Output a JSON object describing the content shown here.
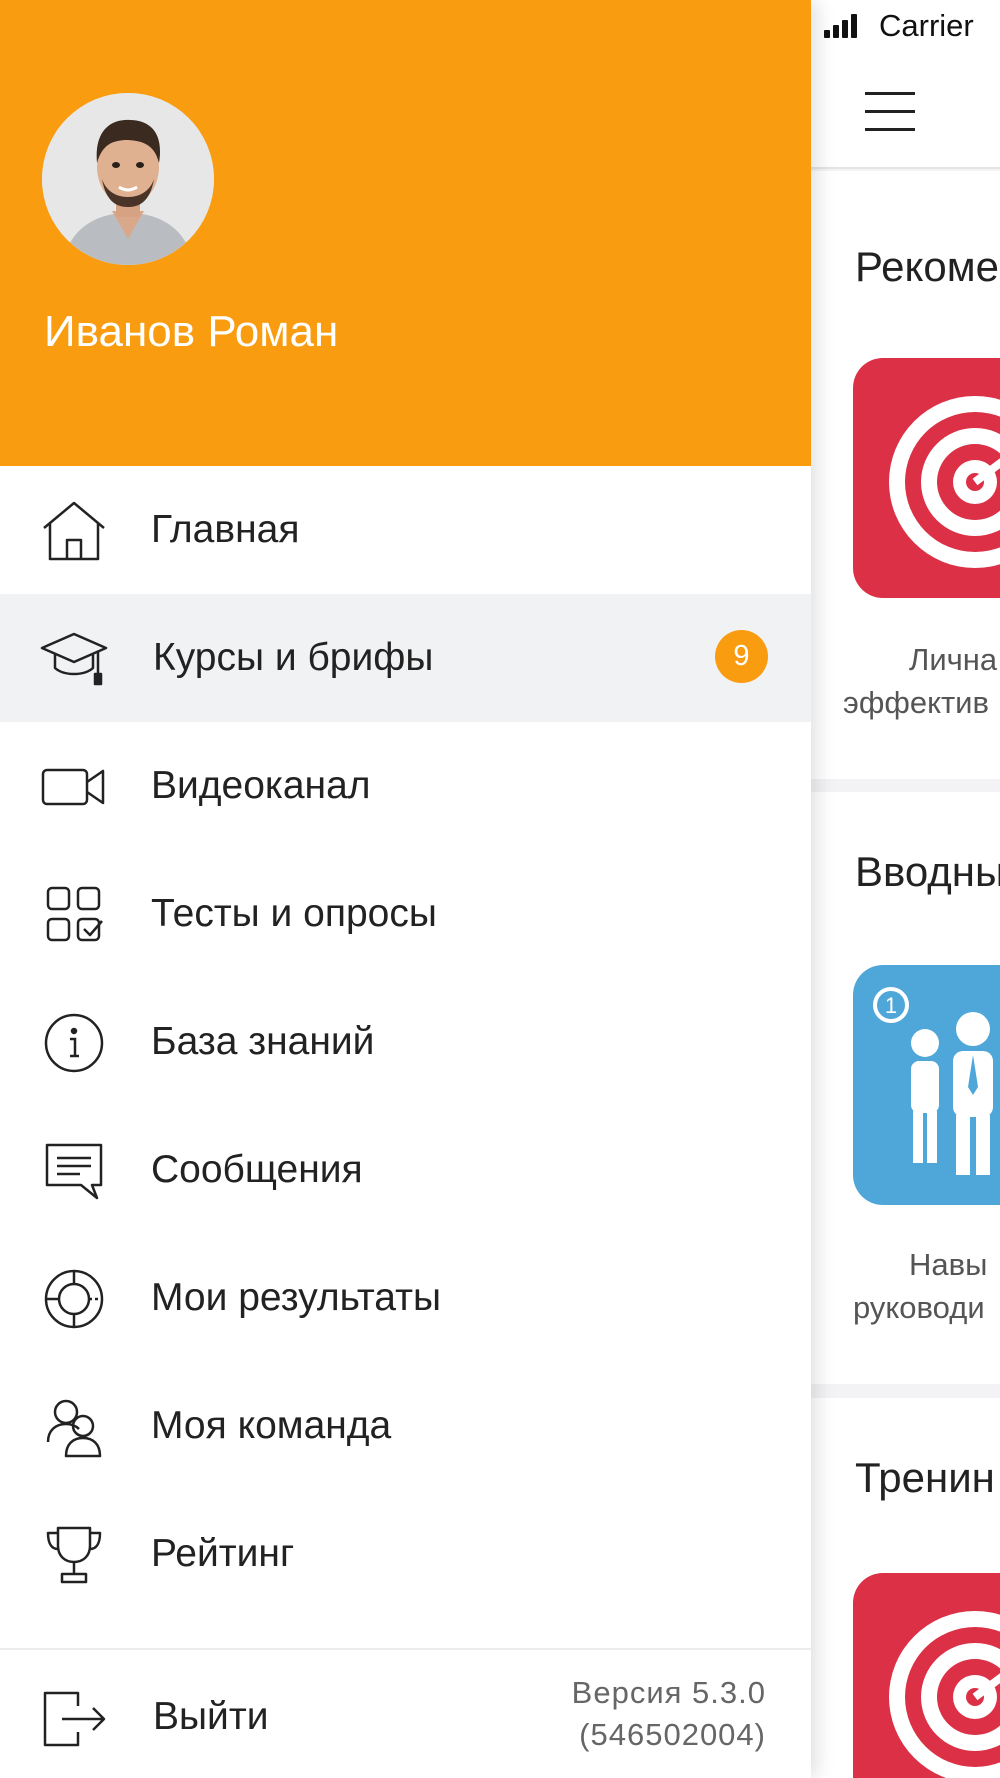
{
  "status_bar": {
    "carrier": "Carrier"
  },
  "background_app": {
    "sections": [
      {
        "title": "Рекоме",
        "tile_color": "#db3045",
        "tile_icon": "target-icon",
        "caption": [
          "Лична",
          "эффектив"
        ]
      },
      {
        "title": "Вводны",
        "tile_color": "#4fa6d8",
        "tile_icon": "people-icon",
        "tile_badge": "1",
        "caption": [
          "Навы",
          "руководи"
        ]
      },
      {
        "title": "Тренин",
        "tile_color": "#db3045",
        "tile_icon": "target-icon"
      }
    ]
  },
  "drawer": {
    "header_color": "#f99c10",
    "user_name": "Иванов Роман",
    "menu": [
      {
        "id": "home",
        "label": "Главная",
        "icon": "home-icon"
      },
      {
        "id": "courses",
        "label": "Курсы и брифы",
        "icon": "graduation-cap-icon",
        "badge": "9",
        "active": true
      },
      {
        "id": "video",
        "label": "Видеоканал",
        "icon": "video-camera-icon"
      },
      {
        "id": "tests",
        "label": "Тесты и опросы",
        "icon": "tests-grid-icon"
      },
      {
        "id": "knowledge",
        "label": "База знаний",
        "icon": "info-icon"
      },
      {
        "id": "messages",
        "label": "Сообщения",
        "icon": "message-icon"
      },
      {
        "id": "results",
        "label": "Мои результаты",
        "icon": "pie-chart-icon"
      },
      {
        "id": "team",
        "label": "Моя команда",
        "icon": "team-icon"
      },
      {
        "id": "rating",
        "label": "Рейтинг",
        "icon": "trophy-icon"
      }
    ],
    "footer": {
      "logout_label": "Выйти",
      "version_line1": "Версия 5.3.0",
      "version_line2": "(546502004)"
    }
  }
}
